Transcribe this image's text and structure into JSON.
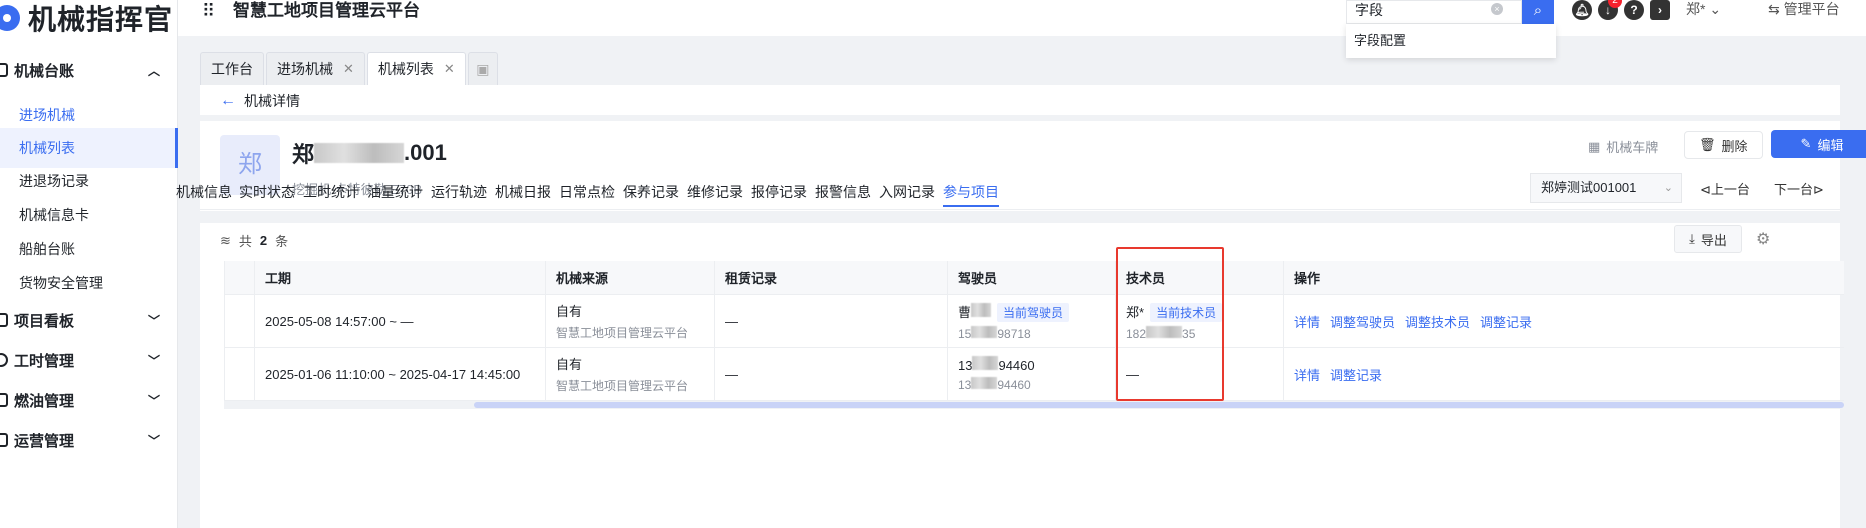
{
  "brand": {
    "name": "机械指挥官"
  },
  "sidebar": {
    "groups": [
      {
        "label": "机械台账",
        "expanded": true
      },
      {
        "label": "项目看板"
      },
      {
        "label": "工时管理"
      },
      {
        "label": "燃油管理"
      },
      {
        "label": "运营管理"
      }
    ],
    "items": [
      {
        "label": "进场机械"
      },
      {
        "label": "机械列表"
      },
      {
        "label": "进退场记录"
      },
      {
        "label": "机械信息卡"
      },
      {
        "label": "船舶台账"
      },
      {
        "label": "货物安全管理"
      }
    ]
  },
  "topbar": {
    "platform_title": "智慧工地项目管理云平台",
    "search_value": "字段",
    "suggestion": "字段配置",
    "badge_count": "2",
    "user": "郑*",
    "manage": "管理平台"
  },
  "tabs": [
    {
      "label": "工作台"
    },
    {
      "label": "进场机械"
    },
    {
      "label": "机械列表"
    }
  ],
  "detail": {
    "back_label": "机械详情",
    "avatar_char": "郑",
    "name_prefix": "郑",
    "name_suffix": ".001",
    "meta": "挖掘机  卡特彼勒  E70B",
    "plate_label": "机械车牌",
    "delete_label": "删除",
    "edit_label": "编辑",
    "select_value": "郑婷测试001001",
    "prev_label": "上一台",
    "next_label": "下一台"
  },
  "subtabs": [
    "机械信息",
    "实时状态",
    "工时统计",
    "油量统计",
    "运行轨迹",
    "机械日报",
    "日常点检",
    "保养记录",
    "维修记录",
    "报停记录",
    "报警信息",
    "入网记录",
    "参与项目"
  ],
  "list": {
    "total_prefix": "共",
    "total_count": "2",
    "total_suffix": "条",
    "export_label": "导出"
  },
  "table": {
    "headers": [
      "工期",
      "机械来源",
      "租赁记录",
      "驾驶员",
      "技术员",
      "操作"
    ],
    "rows": [
      {
        "period": "2025-05-08 14:57:00  ~  —",
        "source": "自有",
        "source_sub": "智慧工地项目管理云平台",
        "lease": "—",
        "driver": "曹",
        "driver_tag": "当前驾驶员",
        "driver_phone_start": "15",
        "driver_phone_end": "98718",
        "tech": "郑*",
        "tech_tag": "当前技术员",
        "tech_phone_start": "182",
        "tech_phone_end": "35",
        "actions": [
          "详情",
          "调整驾驶员",
          "调整技术员",
          "调整记录"
        ]
      },
      {
        "period": "2025-01-06 11:10:00  ~  2025-04-17 14:45:00",
        "source": "自有",
        "source_sub": "智慧工地项目管理云平台",
        "lease": "—",
        "driver_phone_start": "13",
        "driver_phone_end": "94460",
        "driver_sub_start": "13",
        "driver_sub_end": "94460",
        "tech": "—",
        "actions": [
          "详情",
          "调整记录"
        ]
      }
    ]
  },
  "colors": {
    "accent": "#3a6df0",
    "highlight_box": "#e8392e"
  }
}
